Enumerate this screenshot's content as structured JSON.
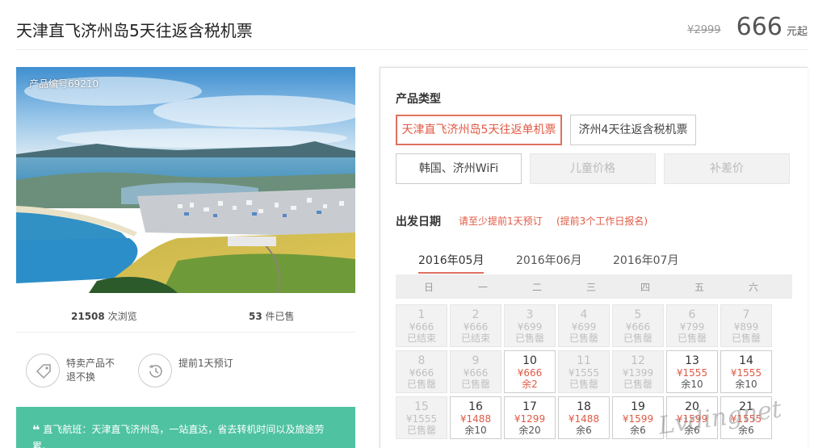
{
  "header": {
    "title": "天津直飞济州岛5天往返含税机票",
    "old_price": "¥2999",
    "price": "666",
    "price_suffix": "元起"
  },
  "photo": {
    "product_no": "产品编号69210"
  },
  "stats": {
    "views_count": "21508",
    "views_label": "次浏览",
    "sold_count": "53",
    "sold_label": "件已售"
  },
  "features": [
    {
      "icon": "tag-icon",
      "text": "特卖产品不退不换"
    },
    {
      "icon": "history-clock-icon",
      "text": "提前1天预订"
    }
  ],
  "promo": {
    "quote_mark": "❝",
    "text": "直飞航班：天津直飞济州岛，一站直达，省去转机时间以及旅途劳累。"
  },
  "product_type": {
    "title": "产品类型",
    "options": [
      {
        "label": "天津直飞济州岛5天往返单机票",
        "state": "selected"
      },
      {
        "label": "济州4天往返含税机票",
        "state": "normal"
      },
      {
        "label": "韩国、济州WiFi",
        "state": "normal"
      },
      {
        "label": "儿童价格",
        "state": "disabled"
      },
      {
        "label": "补差价",
        "state": "disabled"
      }
    ]
  },
  "departure": {
    "title": "出发日期",
    "note1": "请至少提前1天预订",
    "note2": "(提前3个工作日报名)",
    "months": [
      "2016年05月",
      "2016年06月",
      "2016年07月"
    ],
    "active_month": 0,
    "weekdays": [
      "日",
      "一",
      "二",
      "三",
      "四",
      "五",
      "六"
    ],
    "days": [
      {
        "day": "1",
        "price": "¥666",
        "status": "已结束",
        "available": false
      },
      {
        "day": "2",
        "price": "¥666",
        "status": "已结束",
        "available": false
      },
      {
        "day": "3",
        "price": "¥699",
        "status": "已售罄",
        "available": false
      },
      {
        "day": "4",
        "price": "¥699",
        "status": "已售罄",
        "available": false
      },
      {
        "day": "5",
        "price": "¥666",
        "status": "已售罄",
        "available": false
      },
      {
        "day": "6",
        "price": "¥799",
        "status": "已售罄",
        "available": false
      },
      {
        "day": "7",
        "price": "¥899",
        "status": "已售罄",
        "available": false
      },
      {
        "day": "8",
        "price": "¥666",
        "status": "已售罄",
        "available": false
      },
      {
        "day": "9",
        "price": "¥666",
        "status": "已售罄",
        "available": false
      },
      {
        "day": "10",
        "price": "¥666",
        "status": "余2",
        "available": true,
        "red_status": true
      },
      {
        "day": "11",
        "price": "¥1555",
        "status": "已售罄",
        "available": false
      },
      {
        "day": "12",
        "price": "¥1399",
        "status": "已售罄",
        "available": false
      },
      {
        "day": "13",
        "price": "¥1555",
        "status": "余10",
        "available": true
      },
      {
        "day": "14",
        "price": "¥1555",
        "status": "余10",
        "available": true
      },
      {
        "day": "15",
        "price": "¥1555",
        "status": "已售罄",
        "available": false
      },
      {
        "day": "16",
        "price": "¥1488",
        "status": "余10",
        "available": true
      },
      {
        "day": "17",
        "price": "¥1299",
        "status": "余20",
        "available": true
      },
      {
        "day": "18",
        "price": "¥1488",
        "status": "余6",
        "available": true
      },
      {
        "day": "19",
        "price": "¥1599",
        "status": "余6",
        "available": true
      },
      {
        "day": "20",
        "price": "¥1599",
        "status": "余6",
        "available": true
      },
      {
        "day": "21",
        "price": "¥1555",
        "status": "余6",
        "available": true
      }
    ]
  },
  "watermark": "Lvdingnet",
  "colors": {
    "accent": "#e05a45",
    "promo_bg": "#4fc3a1"
  }
}
